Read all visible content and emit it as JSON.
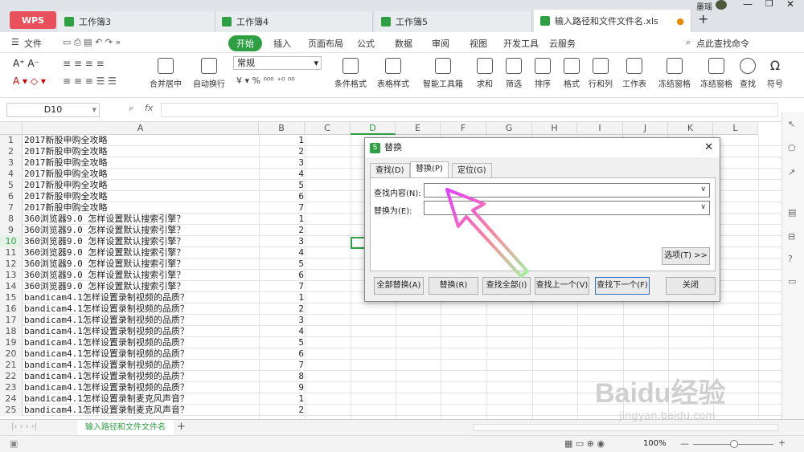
{
  "app": {
    "wps_label": "WPS",
    "user": "墨瑶"
  },
  "tabs": [
    {
      "label": "工作簿3",
      "color": "#2ea043"
    },
    {
      "label": "工作簿4",
      "color": "#2ea043"
    },
    {
      "label": "工作簿5",
      "color": "#2ea043"
    },
    {
      "label": "输入路径和文件文件名.xls",
      "color": "#2ea043"
    }
  ],
  "menu": {
    "file": "文件",
    "items": [
      "开始",
      "插入",
      "页面布局",
      "公式",
      "数据",
      "审阅",
      "视图",
      "开发工具",
      "云服务"
    ],
    "search": "点此查找命令"
  },
  "toolbar": {
    "merge": "合并居中",
    "wrap": "自动换行",
    "number_format": "常规",
    "cond_format": "条件格式",
    "table_style": "表格样式",
    "smart_tools": "智能工具箱",
    "sum": "求和",
    "filter": "筛选",
    "sort": "排序",
    "format": "格式",
    "rowcol": "行和列",
    "worksheet": "工作表",
    "freeze": "冻结窗格",
    "freeze2": "冻结窗格",
    "find": "查找",
    "symbol": "符号"
  },
  "formula_bar": {
    "cell_ref": "D10",
    "fx": "fx"
  },
  "columns": [
    "A",
    "B",
    "C",
    "D",
    "E",
    "F",
    "G",
    "H",
    "I",
    "J",
    "K",
    "L"
  ],
  "rows": [
    {
      "n": "1",
      "a": "2017新股申购全攻略",
      "b": "1"
    },
    {
      "n": "2",
      "a": "2017新股申购全攻略",
      "b": "2"
    },
    {
      "n": "3",
      "a": "2017新股申购全攻略",
      "b": "3"
    },
    {
      "n": "4",
      "a": "2017新股申购全攻略",
      "b": "4"
    },
    {
      "n": "5",
      "a": "2017新股申购全攻略",
      "b": "5"
    },
    {
      "n": "6",
      "a": "2017新股申购全攻略",
      "b": "6"
    },
    {
      "n": "7",
      "a": "2017新股申购全攻略",
      "b": "7"
    },
    {
      "n": "8",
      "a": "360浏览器9.0 怎样设置默认搜索引擎？",
      "b": "1"
    },
    {
      "n": "9",
      "a": "360浏览器9.0 怎样设置默认搜索引擎？",
      "b": "2"
    },
    {
      "n": "10",
      "a": "360浏览器9.0 怎样设置默认搜索引擎？",
      "b": "3"
    },
    {
      "n": "11",
      "a": "360浏览器9.0 怎样设置默认搜索引擎？",
      "b": "4"
    },
    {
      "n": "12",
      "a": "360浏览器9.0 怎样设置默认搜索引擎？",
      "b": "5"
    },
    {
      "n": "13",
      "a": "360浏览器9.0 怎样设置默认搜索引擎？",
      "b": "6"
    },
    {
      "n": "14",
      "a": "360浏览器9.0 怎样设置默认搜索引擎？",
      "b": "7"
    },
    {
      "n": "15",
      "a": "bandicam4.1怎样设置录制视频的品质？",
      "b": "1"
    },
    {
      "n": "16",
      "a": "bandicam4.1怎样设置录制视频的品质？",
      "b": "2"
    },
    {
      "n": "17",
      "a": "bandicam4.1怎样设置录制视频的品质？",
      "b": "3"
    },
    {
      "n": "18",
      "a": "bandicam4.1怎样设置录制视频的品质？",
      "b": "4"
    },
    {
      "n": "19",
      "a": "bandicam4.1怎样设置录制视频的品质？",
      "b": "5"
    },
    {
      "n": "20",
      "a": "bandicam4.1怎样设置录制视频的品质？",
      "b": "6"
    },
    {
      "n": "21",
      "a": "bandicam4.1怎样设置录制视频的品质？",
      "b": "7"
    },
    {
      "n": "22",
      "a": "bandicam4.1怎样设置录制视频的品质？",
      "b": "8"
    },
    {
      "n": "23",
      "a": "bandicam4.1怎样设置录制视频的品质？",
      "b": "9"
    },
    {
      "n": "24",
      "a": "bandicam4.1怎样设置录制麦克风声音？",
      "b": "1"
    },
    {
      "n": "25",
      "a": "bandicam4.1怎样设置录制麦克风声音？",
      "b": "2"
    }
  ],
  "sheet_tab": "输入路径和文件文件名",
  "status": {
    "zoom": "100%"
  },
  "dialog": {
    "title": "替换",
    "tabs": [
      "查找(D)",
      "替换(P)",
      "定位(G)"
    ],
    "find_label": "查找内容(N):",
    "find_value": "",
    "replace_label": "替换为(E):",
    "replace_value": "",
    "options": "选项(T) >>",
    "buttons": [
      "全部替换(A)",
      "替换(R)",
      "查找全部(I)",
      "查找上一个(V)",
      "查找下一个(F)",
      "关闭"
    ]
  },
  "watermark": {
    "text": "Baidu经验",
    "url": "jingyan.baidu.com"
  }
}
